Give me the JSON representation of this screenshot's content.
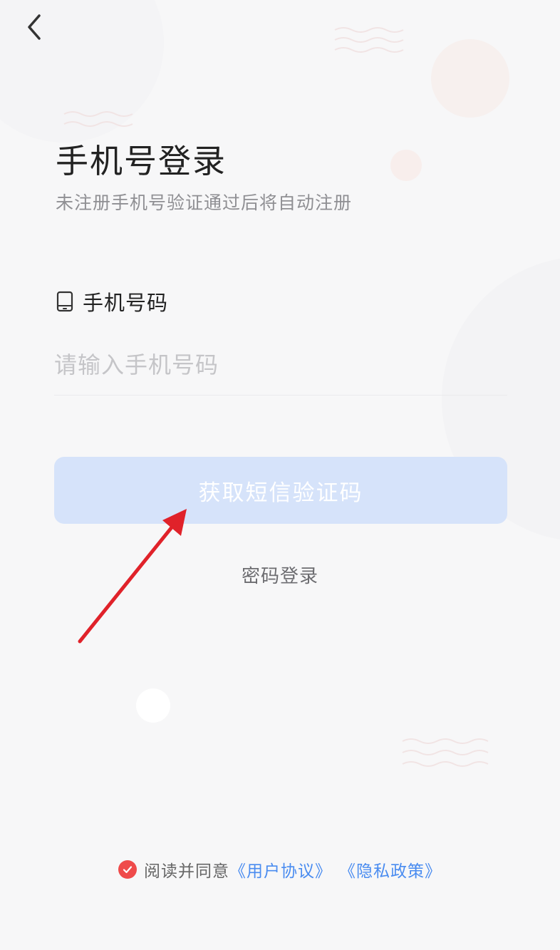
{
  "header": {
    "back_icon": "chevron-left-icon"
  },
  "page": {
    "title": "手机号登录",
    "subtitle": "未注册手机号验证通过后将自动注册"
  },
  "phone_field": {
    "icon": "mobile-phone-icon",
    "label": "手机号码",
    "placeholder": "请输入手机号码",
    "value": ""
  },
  "actions": {
    "sms_button_label": "获取短信验证码",
    "password_login_label": "密码登录"
  },
  "agreement": {
    "checked": true,
    "prefix": "阅读并同意",
    "user_agreement": "《用户协议》",
    "privacy_policy": "《隐私政策》"
  },
  "colors": {
    "button_bg": "#d6e3fa",
    "link": "#4a8cf0",
    "check": "#ef4b4b",
    "annotation_arrow": "#e0222a"
  }
}
